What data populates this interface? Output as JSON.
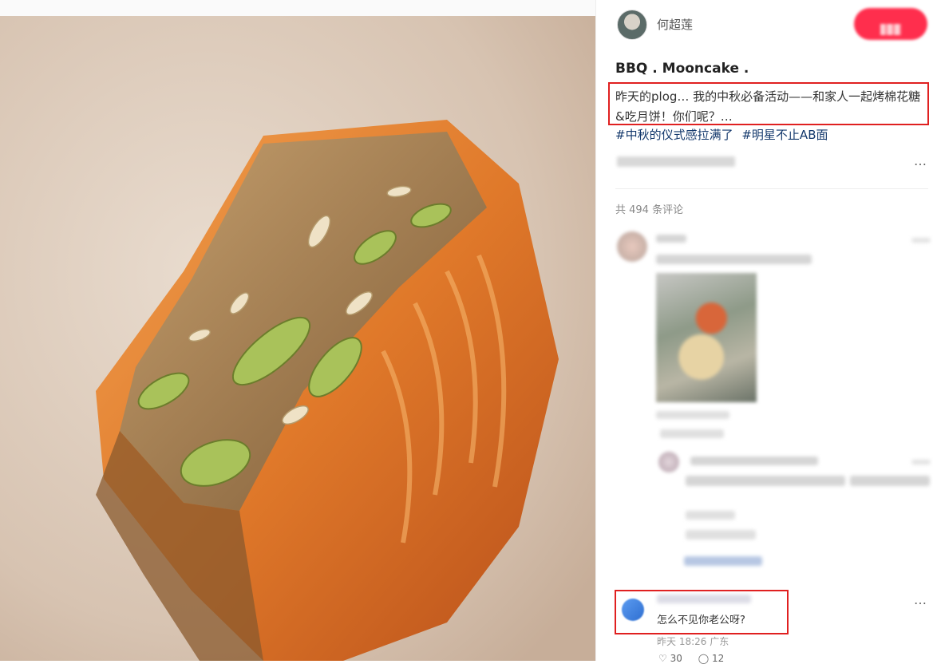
{
  "author": {
    "name": "何超莲",
    "follow_label": ""
  },
  "post": {
    "title": "BBQ . Mooncake .",
    "description": "昨天的plog… 我的中秋必备活动——和家人一起烤棉花糖&吃月饼！你们呢？…",
    "tags": [
      "#中秋的仪式感拉满了",
      "#明星不止AB面"
    ],
    "more_symbol": "…"
  },
  "comments": {
    "count_label": "共 494 条评论",
    "highlighted": {
      "text": "怎么不见你老公呀?",
      "meta": "昨天 18:26 广东",
      "likes": "30",
      "replies": "12",
      "more_symbol": "…"
    }
  },
  "icons": {
    "like": "heart-icon",
    "reply": "comment-icon"
  },
  "colors": {
    "accent": "#ff2e4d",
    "highlight_border": "#e02020",
    "tag": "#13386c"
  }
}
